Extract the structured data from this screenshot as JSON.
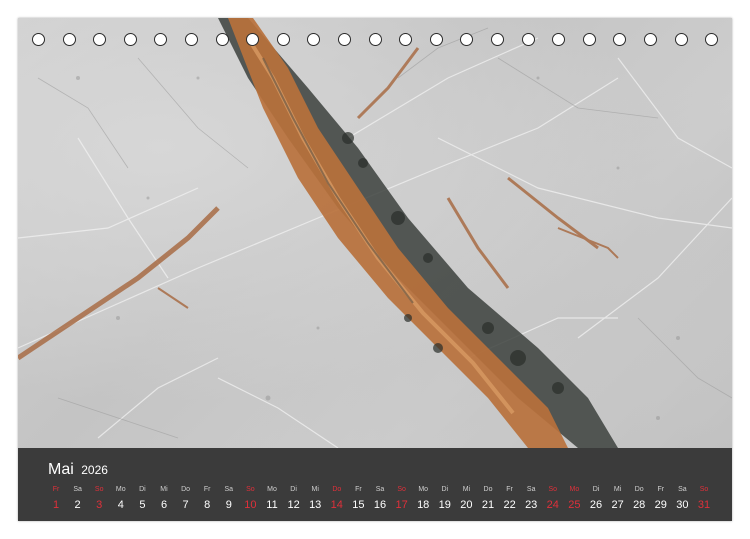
{
  "calendar": {
    "month": "Mai",
    "year": "2026",
    "days": [
      {
        "name": "Fr",
        "num": "1",
        "red": true
      },
      {
        "name": "Sa",
        "num": "2",
        "red": false
      },
      {
        "name": "So",
        "num": "3",
        "red": true
      },
      {
        "name": "Mo",
        "num": "4",
        "red": false
      },
      {
        "name": "Di",
        "num": "5",
        "red": false
      },
      {
        "name": "Mi",
        "num": "6",
        "red": false
      },
      {
        "name": "Do",
        "num": "7",
        "red": false
      },
      {
        "name": "Fr",
        "num": "8",
        "red": false
      },
      {
        "name": "Sa",
        "num": "9",
        "red": false
      },
      {
        "name": "So",
        "num": "10",
        "red": true
      },
      {
        "name": "Mo",
        "num": "11",
        "red": false
      },
      {
        "name": "Di",
        "num": "12",
        "red": false
      },
      {
        "name": "Mi",
        "num": "13",
        "red": false
      },
      {
        "name": "Do",
        "num": "14",
        "red": true
      },
      {
        "name": "Fr",
        "num": "15",
        "red": false
      },
      {
        "name": "Sa",
        "num": "16",
        "red": false
      },
      {
        "name": "So",
        "num": "17",
        "red": true
      },
      {
        "name": "Mo",
        "num": "18",
        "red": false
      },
      {
        "name": "Di",
        "num": "19",
        "red": false
      },
      {
        "name": "Mi",
        "num": "20",
        "red": false
      },
      {
        "name": "Do",
        "num": "21",
        "red": false
      },
      {
        "name": "Fr",
        "num": "22",
        "red": false
      },
      {
        "name": "Sa",
        "num": "23",
        "red": false
      },
      {
        "name": "So",
        "num": "24",
        "red": true
      },
      {
        "name": "Mo",
        "num": "25",
        "red": true
      },
      {
        "name": "Di",
        "num": "26",
        "red": false
      },
      {
        "name": "Mi",
        "num": "27",
        "red": false
      },
      {
        "name": "Do",
        "num": "28",
        "red": false
      },
      {
        "name": "Fr",
        "num": "29",
        "red": false
      },
      {
        "name": "Sa",
        "num": "30",
        "red": false
      },
      {
        "name": "So",
        "num": "31",
        "red": true
      }
    ]
  },
  "colors": {
    "footer_background": "#3b3b3b",
    "holiday_red": "#e0303a",
    "stone_grey": "#c8c8c8",
    "vein_rust": "#b8703e",
    "vein_dark": "#3a3f3a"
  }
}
